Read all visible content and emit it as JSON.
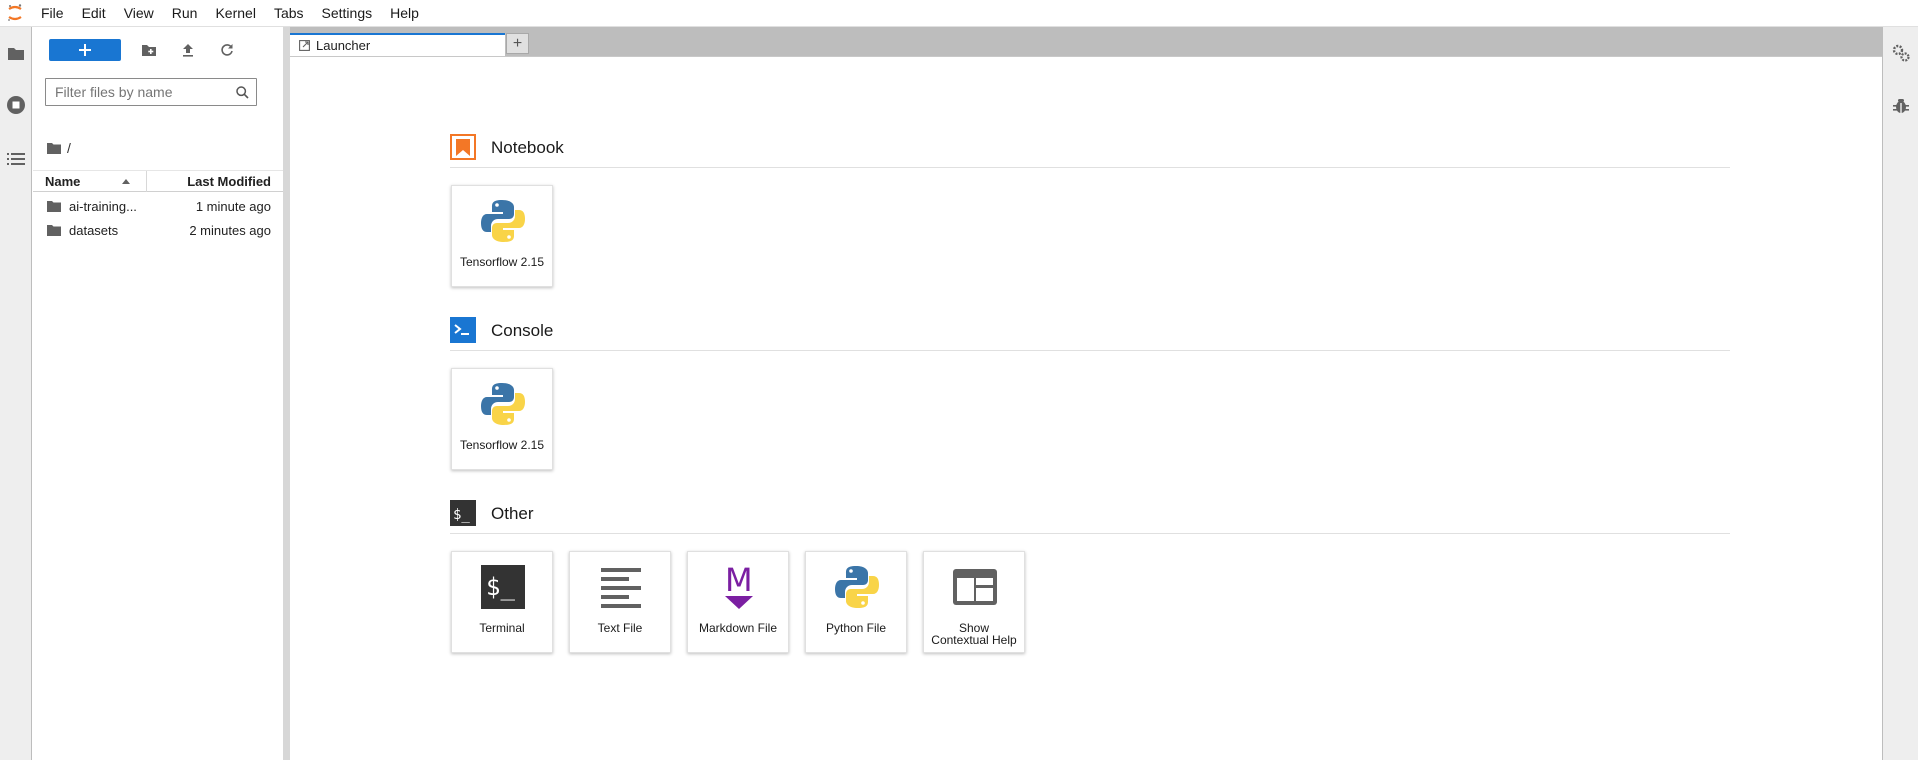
{
  "menubar": {
    "items": [
      "File",
      "Edit",
      "View",
      "Run",
      "Kernel",
      "Tabs",
      "Settings",
      "Help"
    ]
  },
  "filebrowser": {
    "filter_placeholder": "Filter files by name",
    "breadcrumb": "/",
    "columns": {
      "name": "Name",
      "modified": "Last Modified"
    },
    "files": [
      {
        "name": "ai-training...",
        "modified": "1 minute ago",
        "icon": "folder-icon"
      },
      {
        "name": "datasets",
        "modified": "2 minutes ago",
        "icon": "folder-icon"
      }
    ]
  },
  "tabs": [
    {
      "label": "Launcher"
    }
  ],
  "launcher": {
    "sections": [
      {
        "title": "Notebook",
        "items": [
          {
            "label": "Tensorflow 2.15",
            "icon": "python-icon"
          }
        ]
      },
      {
        "title": "Console",
        "items": [
          {
            "label": "Tensorflow 2.15",
            "icon": "python-icon"
          }
        ]
      },
      {
        "title": "Other",
        "items": [
          {
            "label": "Terminal",
            "icon": "terminal-icon"
          },
          {
            "label": "Text File",
            "icon": "text-file-icon"
          },
          {
            "label": "Markdown File",
            "icon": "markdown-icon"
          },
          {
            "label": "Python File",
            "icon": "python-icon"
          },
          {
            "label_line1": "Show",
            "label_line2": "Contextual Help",
            "icon": "contextual-help-icon"
          }
        ]
      }
    ]
  },
  "colors": {
    "accent": "#1976d2",
    "notebook": "#f37726",
    "console": "#1976d2",
    "other": "#333333",
    "markdown": "#7b1fa2"
  }
}
